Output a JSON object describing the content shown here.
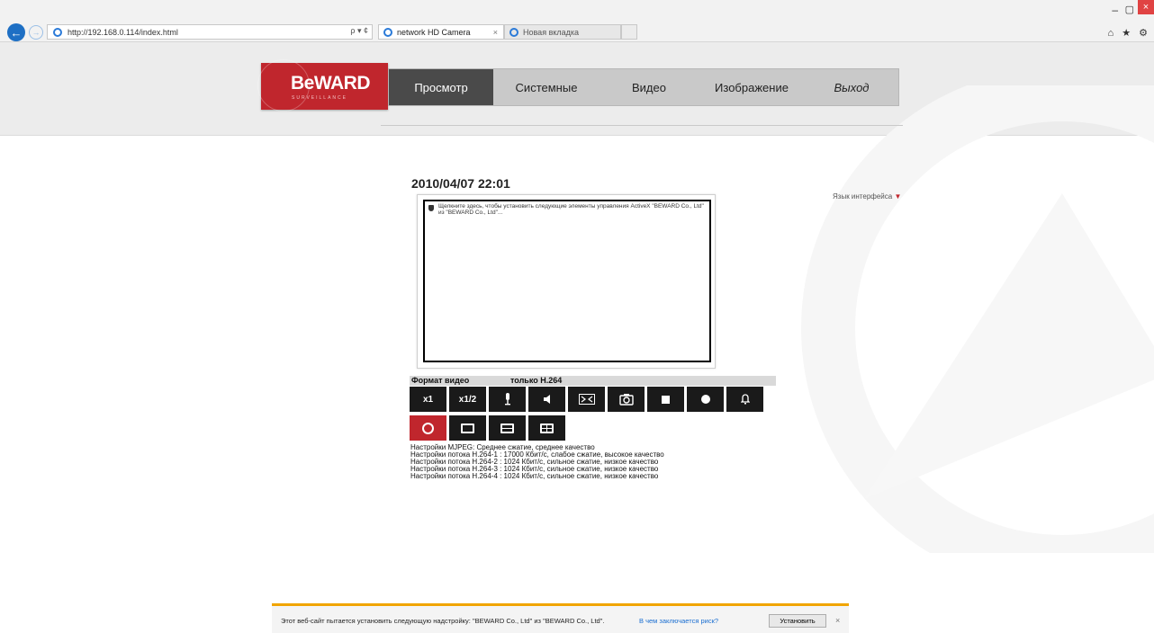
{
  "browser": {
    "url": "http://192.168.0.114/index.html",
    "address_tools": "ρ ▾ ¢",
    "tabs": [
      {
        "label": "network HD Camera",
        "close": "×"
      },
      {
        "label": "Новая вкладка"
      }
    ],
    "window_controls": {
      "minimize": "–",
      "maximize": "▢",
      "close": "×"
    },
    "toolbar_icons": "⌂ ★ ⚙",
    "back_icon": "←",
    "forward_icon": "→"
  },
  "header": {
    "logo_text": "BeWARD",
    "logo_sub": "SURVEILLANCE",
    "nav": [
      "Просмотр",
      "Системные",
      "Видео",
      "Изображение",
      "Выход"
    ],
    "active_nav": "Просмотр",
    "brand_color": "#c0262d"
  },
  "main": {
    "datetime": "2010/04/07 22:01",
    "language_label": "Язык интерфейса",
    "language_arrow": "▼",
    "activex_message": "Щелкните здесь, чтобы установить следующие элементы управления ActiveX \"BEWARD Co., Ltd\" из \"BEWARD Co., Ltd\"...",
    "format_label": "Формат видео",
    "format_value": "только H.264",
    "controls_row1": [
      "x1",
      "x1/2",
      "microphone-icon",
      "speaker-icon",
      "fullscreen-icon",
      "snapshot-icon",
      "stop-icon",
      "record-icon",
      "alarm-bell-icon"
    ],
    "zoom_full": "x1",
    "zoom_half": "x1/2",
    "controls_row2": [
      "stream-circle-icon",
      "single-view-icon",
      "two-split-icon",
      "quad-split-icon"
    ],
    "settings": [
      "Настройки MJPEG: Среднее сжатие, среднее качество",
      "Настройки потока H.264-1 : 17000 Кбит/с, слабое сжатие, высокое качество",
      "Настройки потока H.264-2 : 1024 Кбит/с, сильное сжатие, низкое качество",
      "Настройки потока H.264-3 : 1024 Кбит/с, сильное сжатие, низкое качество",
      "Настройки потока H.264-4 : 1024 Кбит/с, сильное сжатие, низкое качество"
    ]
  },
  "notification": {
    "text": "Этот веб-сайт пытается установить следующую надстройку: \"BEWARD Co., Ltd\" из \"BEWARD Co., Ltd\".",
    "link": "В чем заключается риск?",
    "install": "Установить",
    "close": "×",
    "accent_color": "#f1a500"
  }
}
